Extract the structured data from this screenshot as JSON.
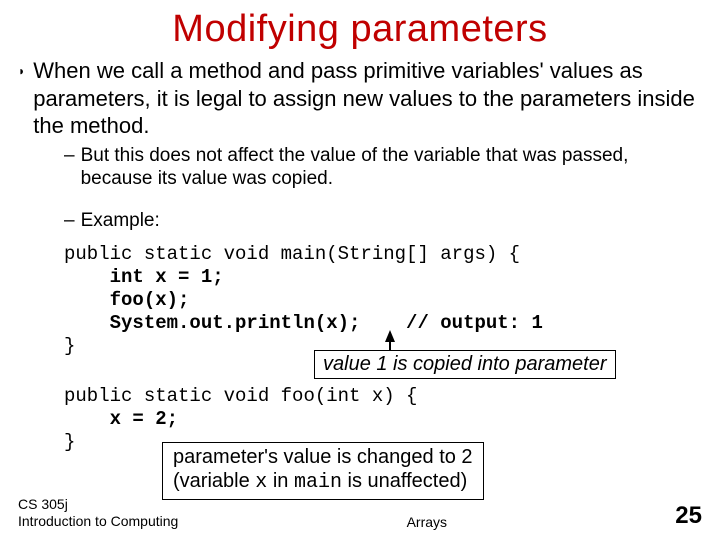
{
  "title": "Modifying parameters",
  "bullet": "When we call a method and pass primitive variables' values as parameters, it is legal to assign new values to the parameters inside the method.",
  "sub1": "But this does not affect the value of the variable that was passed, because its value was copied.",
  "sub2": "Example:",
  "code1_l1": "public static void main(String[] args) {",
  "code1_l2": "    int x = 1;",
  "code1_l3": "    foo(x);",
  "code1_l4": "    System.out.println(x);    // output: 1",
  "code1_l5": "}",
  "code2_l1": "public static void foo(int x) {",
  "code2_l2": "    x = 2;",
  "code2_l3": "}",
  "callout1": "value 1 is copied into parameter",
  "callout2_l1": "parameter's value is changed to 2",
  "callout2_l2a": "(variable ",
  "callout2_x": "x",
  "callout2_l2b": " in ",
  "callout2_main": "main",
  "callout2_l2c": " is unaffected)",
  "footer_left_l1": "CS 305j",
  "footer_left_l2": "Introduction to Computing",
  "footer_center": "Arrays",
  "page_number": "25"
}
